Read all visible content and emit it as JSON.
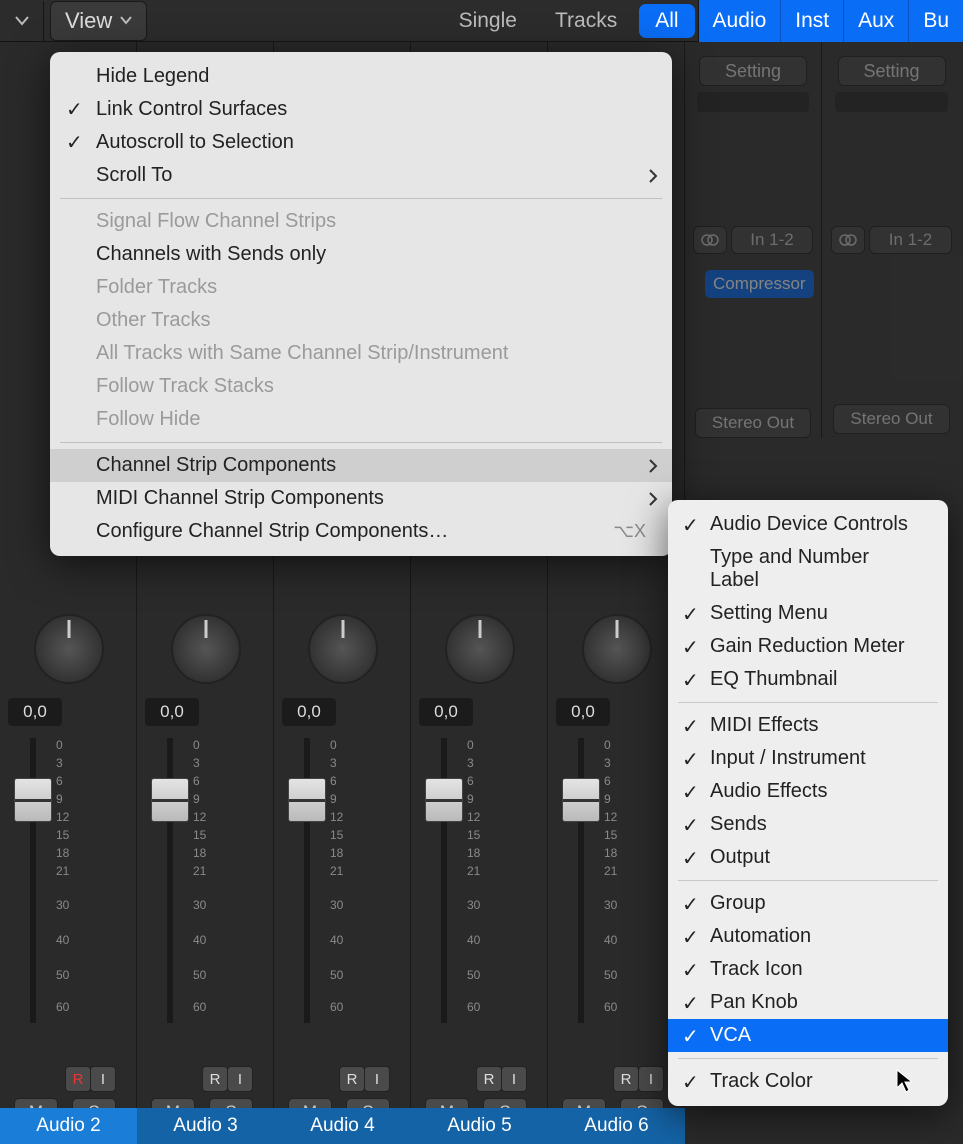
{
  "topbar": {
    "view_label": "View",
    "tabs": {
      "single": "Single",
      "tracks": "Tracks",
      "all": "All"
    },
    "rtabs": {
      "audio": "Audio",
      "inst": "Inst",
      "aux": "Aux",
      "bus": "Bu"
    }
  },
  "strips": [
    {
      "name": "Audio 2",
      "pan": "0,0",
      "rec": true
    },
    {
      "name": "Audio 3",
      "pan": "0,0",
      "rec": false
    },
    {
      "name": "Audio 4",
      "pan": "0,0",
      "rec": false
    },
    {
      "name": "Audio 5",
      "pan": "0,0",
      "rec": false
    },
    {
      "name": "Audio 6",
      "pan": "0,0",
      "rec": false
    }
  ],
  "visible_strip": {
    "setting": "Setting",
    "input": "In 1-2",
    "plugin": "Compressor",
    "output": "Stereo Out"
  },
  "scale_labels": [
    "0",
    "3",
    "6",
    "9",
    "12",
    "15",
    "18",
    "21",
    "30",
    "40",
    "50",
    "60"
  ],
  "ri": {
    "r": "R",
    "i": "I"
  },
  "ms": {
    "m": "M",
    "s": "S"
  },
  "menu": {
    "items": [
      {
        "label": "Hide Legend",
        "checked": false,
        "enabled": true
      },
      {
        "label": "Link Control Surfaces",
        "checked": true,
        "enabled": true
      },
      {
        "label": "Autoscroll to Selection",
        "checked": true,
        "enabled": true
      },
      {
        "label": "Scroll To",
        "checked": false,
        "enabled": true,
        "submenu": true
      }
    ],
    "items2": [
      {
        "label": "Signal Flow Channel Strips",
        "enabled": false
      },
      {
        "label": "Channels with Sends only",
        "enabled": true
      },
      {
        "label": "Folder Tracks",
        "enabled": false
      },
      {
        "label": "Other Tracks",
        "enabled": false
      },
      {
        "label": "All Tracks with Same Channel Strip/Instrument",
        "enabled": false
      },
      {
        "label": "Follow Track Stacks",
        "enabled": false
      },
      {
        "label": "Follow Hide",
        "enabled": false
      }
    ],
    "items3": [
      {
        "label": "Channel Strip Components",
        "submenu": true,
        "highlight": true
      },
      {
        "label": "MIDI Channel Strip Components",
        "submenu": true
      },
      {
        "label": "Configure Channel Strip Components…",
        "shortcut": "⌥X"
      }
    ]
  },
  "submenu": {
    "g1": [
      {
        "label": "Audio Device Controls",
        "checked": true
      },
      {
        "label": "Type and Number Label",
        "checked": false
      },
      {
        "label": "Setting Menu",
        "checked": true
      },
      {
        "label": "Gain Reduction Meter",
        "checked": true
      },
      {
        "label": "EQ Thumbnail",
        "checked": true
      }
    ],
    "g2": [
      {
        "label": "MIDI Effects",
        "checked": true
      },
      {
        "label": "Input / Instrument",
        "checked": true
      },
      {
        "label": "Audio Effects",
        "checked": true
      },
      {
        "label": "Sends",
        "checked": true
      },
      {
        "label": "Output",
        "checked": true
      }
    ],
    "g3": [
      {
        "label": "Group",
        "checked": true
      },
      {
        "label": "Automation",
        "checked": true
      },
      {
        "label": "Track Icon",
        "checked": true
      },
      {
        "label": "Pan Knob",
        "checked": true
      },
      {
        "label": "VCA",
        "checked": true,
        "selected": true
      }
    ],
    "g4": [
      {
        "label": "Track Color",
        "checked": true
      }
    ]
  }
}
